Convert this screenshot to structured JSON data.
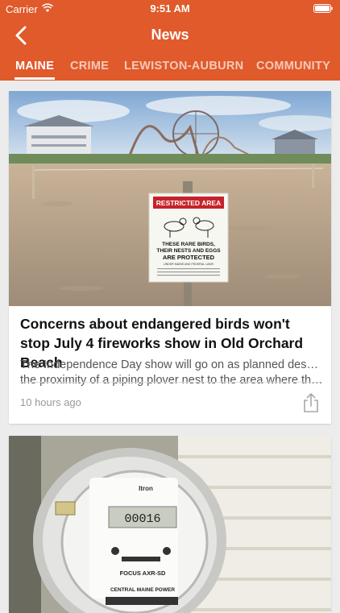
{
  "status_bar": {
    "carrier": "Carrier",
    "time": "9:51 AM"
  },
  "nav": {
    "title": "News",
    "back_icon": "back-chevron-icon"
  },
  "tabs": [
    {
      "label": "MAINE",
      "active": true
    },
    {
      "label": "CRIME",
      "active": false
    },
    {
      "label": "LEWISTON-AUBURN",
      "active": false
    },
    {
      "label": "COMMUNITY",
      "active": false
    }
  ],
  "articles": [
    {
      "image": "beach-restricted-area-photo",
      "sign": {
        "title": "RESTRICTED AREA",
        "line1": "THESE RARE BIRDS,",
        "line2": "THEIR NESTS AND EGGS",
        "line3": "ARE PROTECTED",
        "line4": "UNDER MAINE AND FEDERAL LAWS"
      },
      "headline": "Concerns about endangered birds won't stop July 4 fireworks show in Old Orchard Beach",
      "summary_line1": " The Independence Day show will go on as planned despite",
      "summary_line2": "the proximity of a piping plover nest to the area where the...",
      "timestamp": "10 hours ago"
    },
    {
      "image": "electric-meter-photo",
      "meter": {
        "brand": "Itron",
        "reading": "00016",
        "model": "FOCUS AXR-SD",
        "utility": "CENTRAL MAINE POWER"
      }
    }
  ],
  "colors": {
    "header": "#e05a2b",
    "background": "#ececec"
  }
}
